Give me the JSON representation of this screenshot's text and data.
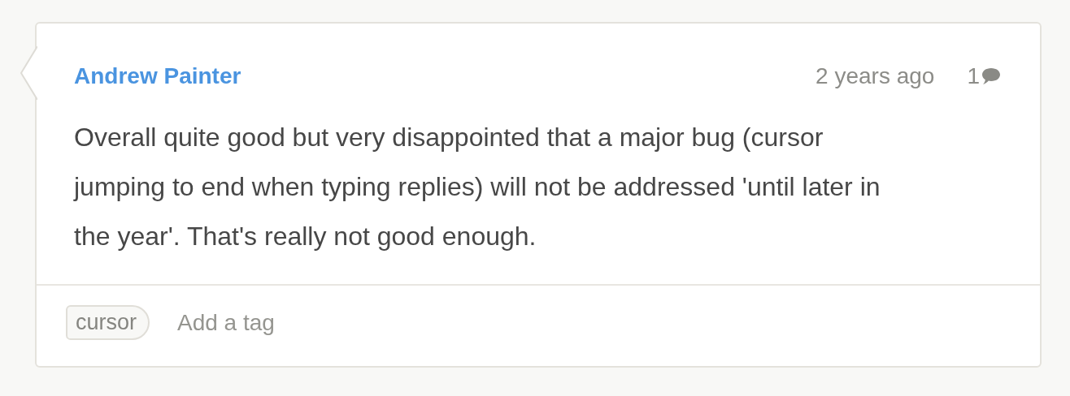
{
  "comment": {
    "author": "Andrew Painter",
    "time": "2 years ago",
    "reply_count": "1",
    "body": "Overall quite good but very disappointed that a major bug (cursor jumping to end when typing replies) will not be addressed 'until later in the year'. That's really not good enough."
  },
  "tags": [
    "cursor"
  ],
  "tag_input": {
    "placeholder": "Add a tag"
  }
}
